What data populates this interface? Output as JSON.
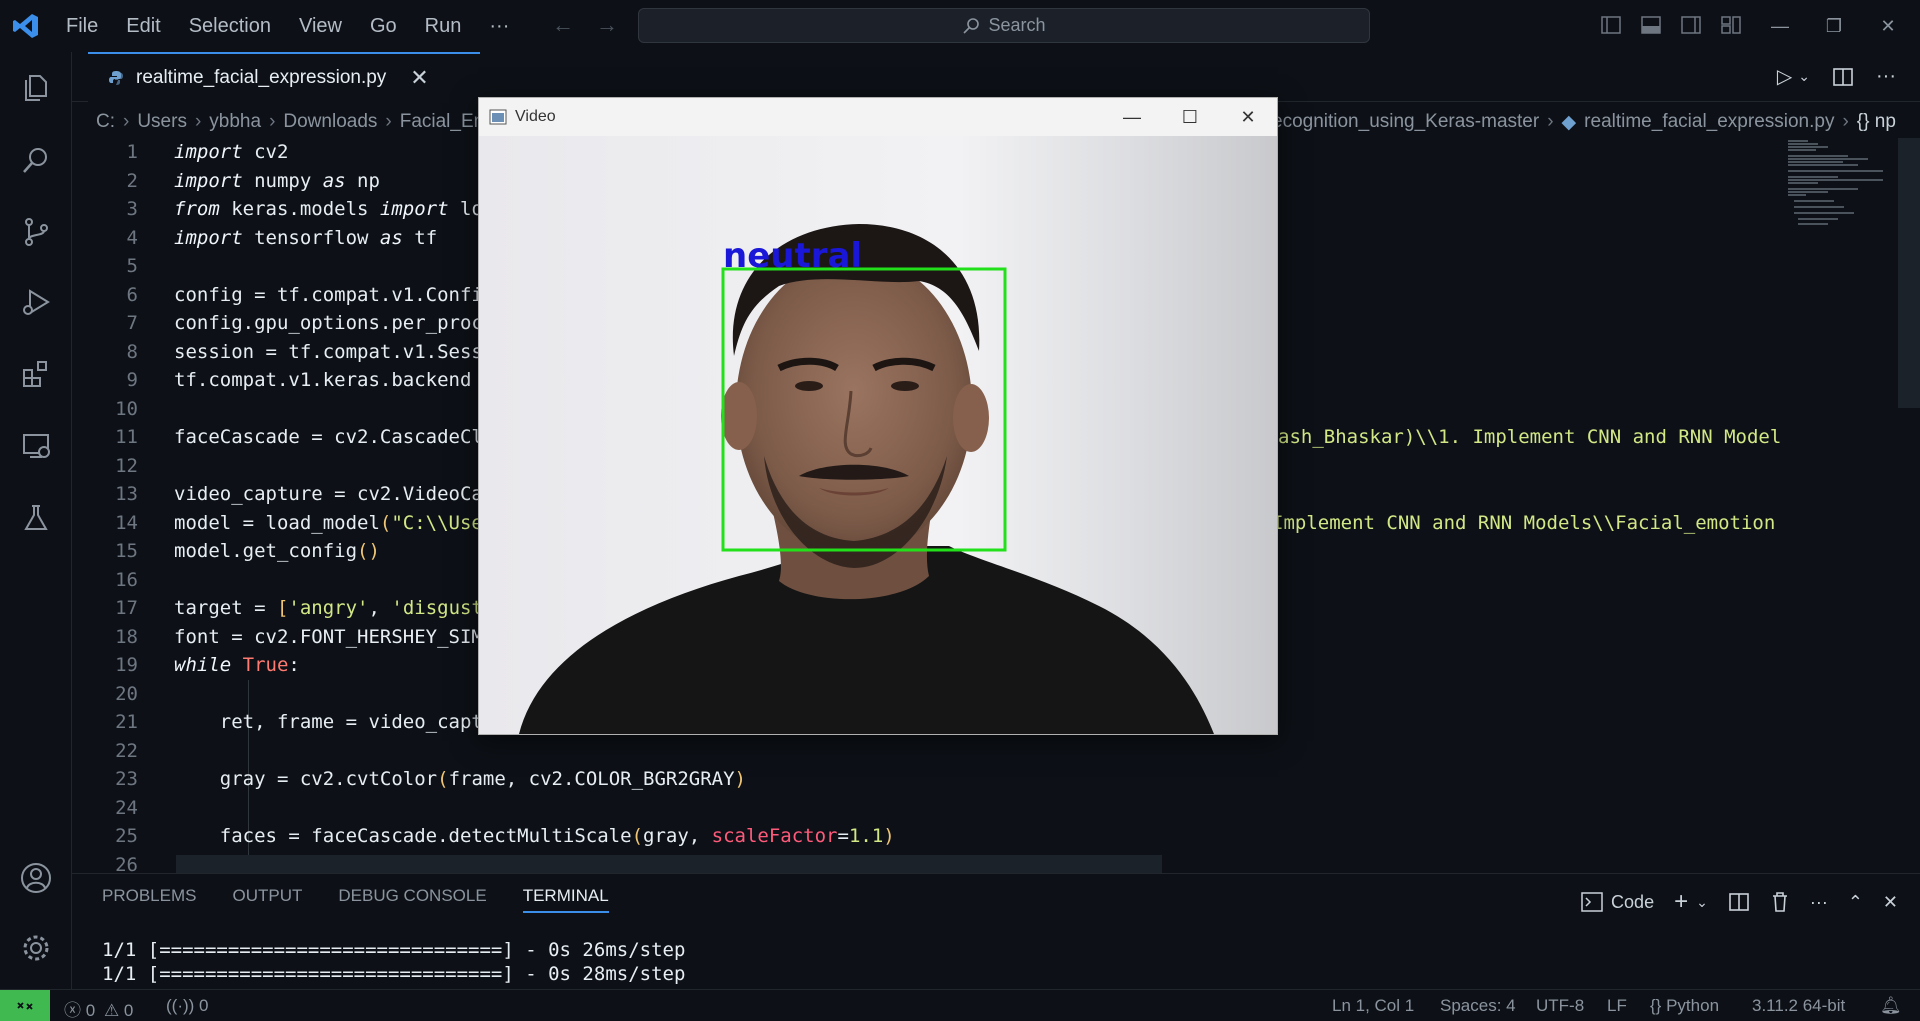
{
  "menu": [
    "File",
    "Edit",
    "Selection",
    "View",
    "Go",
    "Run",
    "···"
  ],
  "search": {
    "placeholder": "Search"
  },
  "tab": {
    "label": "realtime_facial_expression.py"
  },
  "breadcrumb_left": [
    "C:",
    "Users",
    "ybbha",
    "Downloads",
    "Facial_Em"
  ],
  "breadcrumb_right": [
    "ecognition_using_Keras-master",
    "realtime_facial_expression.py",
    "{} np"
  ],
  "code_lines": [
    {
      "n": "1",
      "html": "<span class=\"kw\">import</span> cv2"
    },
    {
      "n": "2",
      "html": "<span class=\"kw\">import</span> numpy <span class=\"kw\">as</span> np"
    },
    {
      "n": "3",
      "html": "<span class=\"kw\">from</span> keras.models <span class=\"kw\">import</span> lo"
    },
    {
      "n": "4",
      "html": "<span class=\"kw\">import</span> tensorflow <span class=\"kw\">as</span> tf"
    },
    {
      "n": "5",
      "html": ""
    },
    {
      "n": "6",
      "html": "config = tf.compat.v1.Confi"
    },
    {
      "n": "7",
      "html": "config.gpu_options.per_proc"
    },
    {
      "n": "8",
      "html": "session = tf.compat.v1.Sess"
    },
    {
      "n": "9",
      "html": "tf.compat.v1.keras.backend"
    },
    {
      "n": "10",
      "html": ""
    },
    {
      "n": "11",
      "html": "faceCascade = cv2.CascadeCl"
    },
    {
      "n": "12",
      "html": ""
    },
    {
      "n": "13",
      "html": "video_capture = cv2.VideoCa"
    },
    {
      "n": "14",
      "html": "model = load_model<span class=\"par\">(</span><span class=\"str\">\"C:\\\\Use</span>"
    },
    {
      "n": "15",
      "html": "model.get_config<span class=\"par\">()</span>"
    },
    {
      "n": "16",
      "html": ""
    },
    {
      "n": "17",
      "html": "target = <span class=\"par\">[</span><span class=\"str\">'angry'</span>, <span class=\"str\">'disgust</span>"
    },
    {
      "n": "18",
      "html": "font = cv2.FONT_HERSHEY_SIM"
    },
    {
      "n": "19",
      "html": "<span class=\"kw\">while</span> <span class=\"tru\">True</span>:"
    },
    {
      "n": "20",
      "html": ""
    },
    {
      "n": "21",
      "html": "    ret, frame = video_capt"
    },
    {
      "n": "22",
      "html": ""
    },
    {
      "n": "23",
      "html": "    gray = cv2.cvtColor<span class=\"par\">(</span>frame, cv2.COLOR_BGR2GRAY<span class=\"par\">)</span>"
    },
    {
      "n": "24",
      "html": ""
    },
    {
      "n": "25",
      "html": "    faces = faceCascade.detectMultiScale<span class=\"par\">(</span>gray, <span class=\"param\">scaleFactor</span>=<span class=\"num\">1.1</span><span class=\"par\">)</span>"
    },
    {
      "n": "26",
      "html": ""
    }
  ],
  "line11_tail": "ash_Bhaskar)\\\\1. Implement CNN and RNN Model",
  "line14_tail": "Implement CNN and RNN Models\\\\Facial_emotion",
  "panel_tabs": [
    "PROBLEMS",
    "OUTPUT",
    "DEBUG CONSOLE",
    "TERMINAL"
  ],
  "terminal_profile": "Code",
  "terminal_lines": [
    "1/1 [==============================] - 0s 26ms/step",
    "1/1 [==============================] - 0s 28ms/step"
  ],
  "status": {
    "errors": "0",
    "warnings": "0",
    "ports": "0",
    "position": "Ln 1, Col 1",
    "spaces": "Spaces: 4",
    "encoding": "UTF-8",
    "eol": "LF",
    "language": "Python",
    "interpreter": "3.11.2 64-bit"
  },
  "video_window": {
    "title": "Video",
    "prediction_label": "neutral"
  },
  "colors": {
    "accent": "#3b8eea",
    "remote": "#3fb950",
    "face_box": "#22e01a",
    "prediction_text": "#1a17d8"
  }
}
